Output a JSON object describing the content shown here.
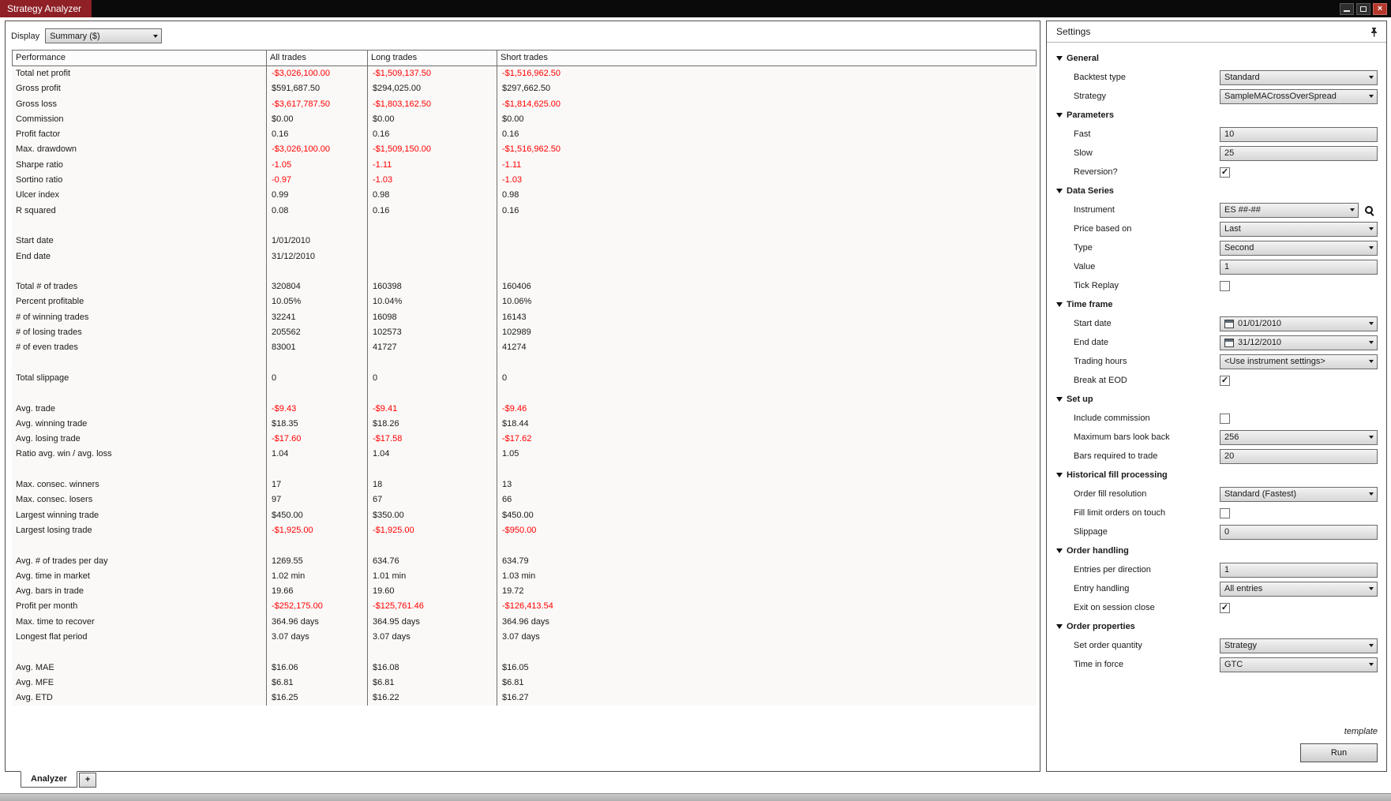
{
  "window": {
    "title": "Strategy Analyzer"
  },
  "icons": {
    "minimize": "minimize-bar",
    "maximize": "square-outline",
    "close": "×",
    "pin": "pushpin",
    "dropdown_arrow": "triangle-down",
    "section_expanded": "triangle-down",
    "checkbox_check": "✓",
    "instrument_search": "magnifier",
    "date_picker": "calendar"
  },
  "colors": {
    "negative_value": "#ff0000",
    "titlebar": "#0a0a0a",
    "brand_tab": "#8e2026",
    "close_button": "#b5372c"
  },
  "toolbar": {
    "display_label": "Display",
    "display_value": "Summary ($)"
  },
  "report": {
    "columns": [
      "Performance",
      "All trades",
      "Long trades",
      "Short trades"
    ],
    "rows": [
      [
        "Total net profit",
        "-$3,026,100.00",
        "-$1,509,137.50",
        "-$1,516,962.50"
      ],
      [
        "Gross profit",
        "$591,687.50",
        "$294,025.00",
        "$297,662.50"
      ],
      [
        "Gross loss",
        "-$3,617,787.50",
        "-$1,803,162.50",
        "-$1,814,625.00"
      ],
      [
        "Commission",
        "$0.00",
        "$0.00",
        "$0.00"
      ],
      [
        "Profit factor",
        "0.16",
        "0.16",
        "0.16"
      ],
      [
        "Max. drawdown",
        "-$3,026,100.00",
        "-$1,509,150.00",
        "-$1,516,962.50"
      ],
      [
        "Sharpe ratio",
        "-1.05",
        "-1.11",
        "-1.11"
      ],
      [
        "Sortino ratio",
        "-0.97",
        "-1.03",
        "-1.03"
      ],
      [
        "Ulcer index",
        "0.99",
        "0.98",
        "0.98"
      ],
      [
        "R squared",
        "0.08",
        "0.16",
        "0.16"
      ],
      [
        "",
        "",
        "",
        ""
      ],
      [
        "Start date",
        "1/01/2010",
        "",
        ""
      ],
      [
        "End date",
        "31/12/2010",
        "",
        ""
      ],
      [
        "",
        "",
        "",
        ""
      ],
      [
        "Total # of trades",
        "320804",
        "160398",
        "160406"
      ],
      [
        "Percent profitable",
        "10.05%",
        "10.04%",
        "10.06%"
      ],
      [
        "# of winning trades",
        "32241",
        "16098",
        "16143"
      ],
      [
        "# of losing trades",
        "205562",
        "102573",
        "102989"
      ],
      [
        "# of even trades",
        "83001",
        "41727",
        "41274"
      ],
      [
        "",
        "",
        "",
        ""
      ],
      [
        "Total slippage",
        "0",
        "0",
        "0"
      ],
      [
        "",
        "",
        "",
        ""
      ],
      [
        "Avg. trade",
        "-$9.43",
        "-$9.41",
        "-$9.46"
      ],
      [
        "Avg. winning trade",
        "$18.35",
        "$18.26",
        "$18.44"
      ],
      [
        "Avg. losing trade",
        "-$17.60",
        "-$17.58",
        "-$17.62"
      ],
      [
        "Ratio avg. win / avg. loss",
        "1.04",
        "1.04",
        "1.05"
      ],
      [
        "",
        "",
        "",
        ""
      ],
      [
        "Max. consec. winners",
        "17",
        "18",
        "13"
      ],
      [
        "Max. consec. losers",
        "97",
        "67",
        "66"
      ],
      [
        "Largest winning trade",
        "$450.00",
        "$350.00",
        "$450.00"
      ],
      [
        "Largest losing trade",
        "-$1,925.00",
        "-$1,925.00",
        "-$950.00"
      ],
      [
        "",
        "",
        "",
        ""
      ],
      [
        "Avg. # of trades per day",
        "1269.55",
        "634.76",
        "634.79"
      ],
      [
        "Avg. time in market",
        "1.02 min",
        "1.01 min",
        "1.03 min"
      ],
      [
        "Avg. bars in trade",
        "19.66",
        "19.60",
        "19.72"
      ],
      [
        "Profit per month",
        "-$252,175.00",
        "-$125,761.46",
        "-$126,413.54"
      ],
      [
        "Max. time to recover",
        "364.96 days",
        "364.95 days",
        "364.96 days"
      ],
      [
        "Longest flat period",
        "3.07 days",
        "3.07 days",
        "3.07 days"
      ],
      [
        "",
        "",
        "",
        ""
      ],
      [
        "Avg. MAE",
        "$16.06",
        "$16.08",
        "$16.05"
      ],
      [
        "Avg. MFE",
        "$6.81",
        "$6.81",
        "$6.81"
      ],
      [
        "Avg. ETD",
        "$16.25",
        "$16.22",
        "$16.27"
      ]
    ]
  },
  "settings": {
    "title": "Settings",
    "template_label": "template",
    "run_label": "Run",
    "sections": [
      {
        "label": "General",
        "items": [
          {
            "label": "Backtest type",
            "control": "select",
            "value": "Standard"
          },
          {
            "label": "Strategy",
            "control": "select",
            "value": "SampleMACrossOverSpread"
          }
        ]
      },
      {
        "label": "Parameters",
        "items": [
          {
            "label": "Fast",
            "control": "input",
            "value": "10"
          },
          {
            "label": "Slow",
            "control": "input",
            "value": "25"
          },
          {
            "label": "Reversion?",
            "control": "checkbox",
            "value": "checked"
          }
        ]
      },
      {
        "label": "Data Series",
        "items": [
          {
            "label": "Instrument",
            "control": "select-search",
            "value": "ES ##-##"
          },
          {
            "label": "Price based on",
            "control": "select",
            "value": "Last"
          },
          {
            "label": "Type",
            "control": "select",
            "value": "Second"
          },
          {
            "label": "Value",
            "control": "input",
            "value": "1"
          },
          {
            "label": "Tick Replay",
            "control": "checkbox",
            "value": "unchecked"
          }
        ]
      },
      {
        "label": "Time frame",
        "items": [
          {
            "label": "Start date",
            "control": "date",
            "value": "01/01/2010"
          },
          {
            "label": "End date",
            "control": "date",
            "value": "31/12/2010"
          },
          {
            "label": "Trading hours",
            "control": "select",
            "value": "<Use instrument settings>"
          },
          {
            "label": "Break at EOD",
            "control": "checkbox",
            "value": "checked"
          }
        ]
      },
      {
        "label": "Set up",
        "items": [
          {
            "label": "Include commission",
            "control": "checkbox",
            "value": "unchecked"
          },
          {
            "label": "Maximum bars look back",
            "control": "select",
            "value": "256"
          },
          {
            "label": "Bars required to trade",
            "control": "input",
            "value": "20"
          }
        ]
      },
      {
        "label": "Historical fill processing",
        "items": [
          {
            "label": "Order fill resolution",
            "control": "select",
            "value": "Standard (Fastest)"
          },
          {
            "label": "Fill limit orders on touch",
            "control": "checkbox",
            "value": "unchecked"
          },
          {
            "label": "Slippage",
            "control": "input",
            "value": "0"
          }
        ]
      },
      {
        "label": "Order handling",
        "items": [
          {
            "label": "Entries per direction",
            "control": "input",
            "value": "1"
          },
          {
            "label": "Entry handling",
            "control": "select",
            "value": "All entries"
          },
          {
            "label": "Exit on session close",
            "control": "checkbox",
            "value": "checked"
          }
        ]
      },
      {
        "label": "Order properties",
        "items": [
          {
            "label": "Set order quantity",
            "control": "select",
            "value": "Strategy"
          },
          {
            "label": "Time in force",
            "control": "select",
            "value": "GTC"
          }
        ]
      }
    ]
  },
  "tabs": {
    "analyzer_label": "Analyzer",
    "add_label": "+"
  }
}
